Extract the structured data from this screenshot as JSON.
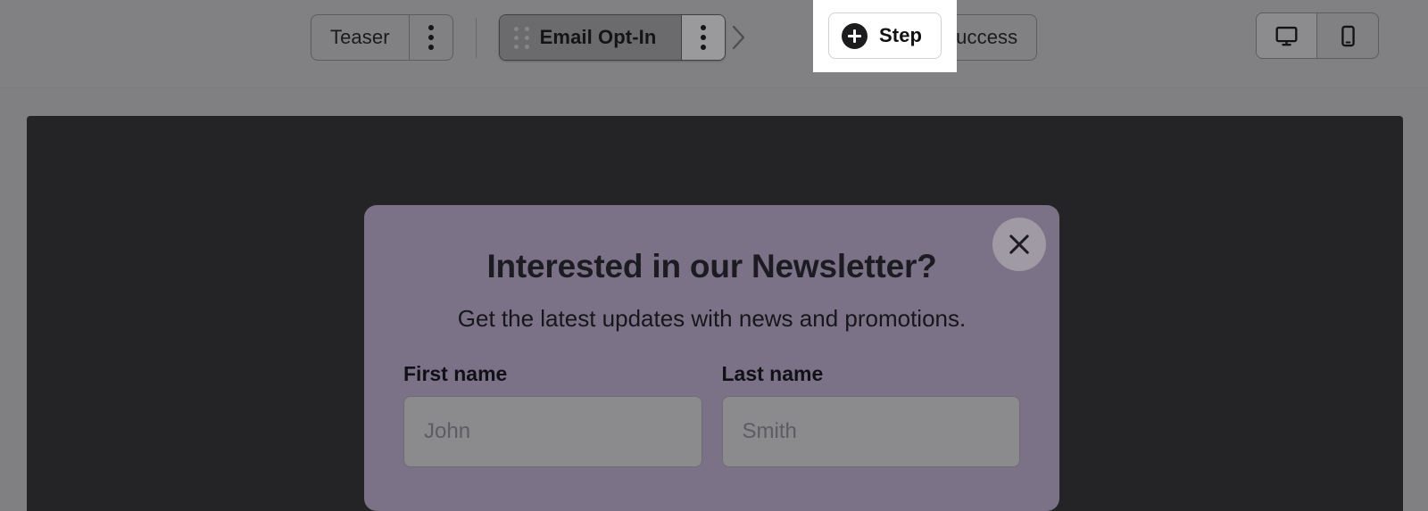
{
  "toolbar": {
    "steps": [
      {
        "label": "Teaser",
        "state": "default",
        "menu_icon": "more-vertical-icon"
      },
      {
        "label": "Email Opt-In",
        "state": "active",
        "drag_icon": "drag-handle-icon",
        "menu_icon": "more-vertical-icon"
      },
      {
        "label": "Success",
        "state": "default"
      }
    ],
    "add_step": {
      "label": "Step",
      "icon": "plus-circle-icon"
    },
    "viewport": {
      "desktop": {
        "icon": "desktop-icon",
        "selected": true
      },
      "mobile": {
        "icon": "mobile-icon",
        "selected": false
      }
    },
    "chevron_icon": "chevron-right-icon"
  },
  "canvas": {
    "modal": {
      "title": "Interested in our Newsletter?",
      "subtitle": "Get the latest updates with news and promotions.",
      "close_icon": "close-x-icon",
      "fields": [
        {
          "label": "First name",
          "value": "",
          "placeholder": "John"
        },
        {
          "label": "Last name",
          "value": "",
          "placeholder": "Smith"
        }
      ]
    }
  },
  "colors": {
    "toolbar_bg": "#818183",
    "canvas_bg": "#242426",
    "modal_bg": "#7b7287",
    "accent_dark": "#1c1c1e",
    "panel_highlight": "#ffffff",
    "input_bg": "#8b8a8c"
  }
}
